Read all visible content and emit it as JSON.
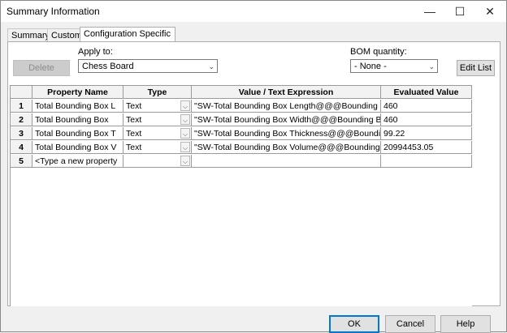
{
  "window": {
    "title": "Summary Information"
  },
  "tabs": [
    {
      "label": "Summary"
    },
    {
      "label": "Custom"
    },
    {
      "label": "Configuration Specific"
    }
  ],
  "toolbar": {
    "delete_label": "Delete",
    "apply_to_label": "Apply to:",
    "apply_to_value": "Chess Board",
    "bom_label": "BOM quantity:",
    "bom_value": "- None -",
    "edit_list_label": "Edit List"
  },
  "table": {
    "headers": [
      "Property Name",
      "Type",
      "Value / Text Expression",
      "Evaluated Value"
    ],
    "rows": [
      {
        "num": "1",
        "name": "Total Bounding Box L",
        "type": "Text",
        "value": "\"SW-Total Bounding Box Length@@@Bounding B",
        "evaluated": "460"
      },
      {
        "num": "2",
        "name": "Total Bounding Box",
        "type": "Text",
        "value": "\"SW-Total Bounding Box Width@@@Bounding B",
        "evaluated": "460"
      },
      {
        "num": "3",
        "name": "Total Bounding Box T",
        "type": "Text",
        "value": "\"SW-Total Bounding Box Thickness@@@Boundin",
        "evaluated": "99.22"
      },
      {
        "num": "4",
        "name": "Total Bounding Box V",
        "type": "Text",
        "value": "\"SW-Total Bounding Box Volume@@@Bounding",
        "evaluated": "20994453.05"
      },
      {
        "num": "5",
        "name": "<Type a new property",
        "type": "",
        "value": "",
        "evaluated": ""
      }
    ]
  },
  "footer": {
    "ok_label": "OK",
    "cancel_label": "Cancel",
    "help_label": "Help"
  }
}
